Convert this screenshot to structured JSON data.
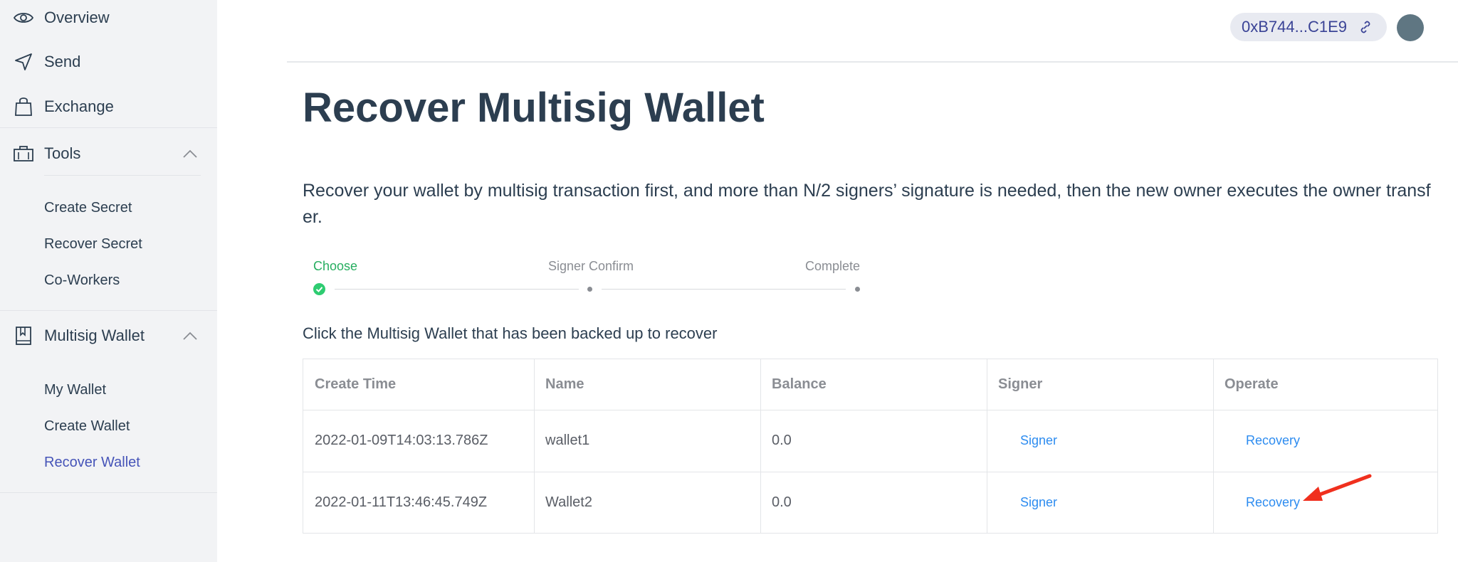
{
  "sidebar": {
    "items": [
      {
        "label": "Overview",
        "icon": "eye-icon"
      },
      {
        "label": "Send",
        "icon": "send-icon"
      },
      {
        "label": "Exchange",
        "icon": "shopping-bag-icon"
      },
      {
        "label": "Tools",
        "icon": "toolbox-icon",
        "expanded": true
      },
      {
        "label": "Multisig Wallet",
        "icon": "bookmark-book-icon",
        "expanded": true
      }
    ],
    "tools_sub": [
      "Create Secret",
      "Recover Secret",
      "Co-Workers"
    ],
    "multisig_sub": [
      "My Wallet",
      "Create Wallet",
      "Recover Wallet"
    ],
    "active_sub": "Recover Wallet"
  },
  "header": {
    "account_address": "0xB744...C1E9"
  },
  "main": {
    "title": "Recover Multisig Wallet",
    "description": "Recover your wallet by multisig transaction first, and more than N/2 signers’ signature is needed, then the new owner executes the owner transfer.",
    "steps": [
      "Choose",
      "Signer Confirm",
      "Complete"
    ],
    "current_step": 0,
    "instruction": "Click the Multisig Wallet that has been backed up to recover",
    "table": {
      "columns": [
        "Create Time",
        "Name",
        "Balance",
        "Signer",
        "Operate"
      ],
      "rows": [
        {
          "create_time": "2022-01-09T14:03:13.786Z",
          "name": "wallet1",
          "balance": "0.0",
          "signer": "Signer",
          "operate": "Recovery"
        },
        {
          "create_time": "2022-01-11T13:46:45.749Z",
          "name": "Wallet2",
          "balance": "0.0",
          "signer": "Signer",
          "operate": "Recovery"
        }
      ]
    }
  },
  "colors": {
    "sidebar_bg": "#f2f3f5",
    "active_nav": "#4654b8",
    "step_active": "#27ae60",
    "link": "#2d8cf0",
    "annotation_arrow": "#f0301e",
    "avatar": "#5f7682"
  }
}
